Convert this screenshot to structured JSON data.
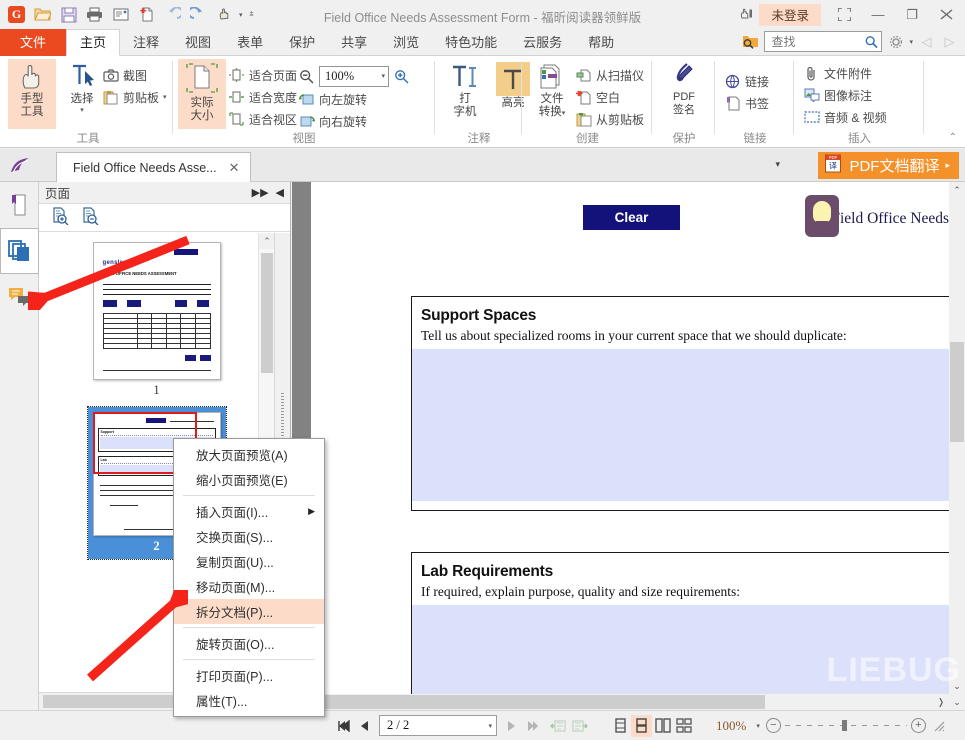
{
  "window": {
    "title": "Field Office Needs Assessment Form - 福昕阅读器领鲜版",
    "login_status": "未登录",
    "minimize": "—",
    "maximize": "❐",
    "close": "✕",
    "restore_icon": "⛶"
  },
  "quick_access": [
    {
      "name": "app-logo",
      "glyph": "G"
    },
    {
      "name": "open-icon",
      "glyph": "📂"
    },
    {
      "name": "save-icon",
      "glyph": "💾"
    },
    {
      "name": "print-icon",
      "glyph": "🖨"
    },
    {
      "name": "email-icon",
      "glyph": "✉"
    },
    {
      "name": "new-from-file-icon",
      "glyph": "❇"
    },
    {
      "name": "undo-icon",
      "glyph": "↶"
    },
    {
      "name": "redo-icon",
      "glyph": "↷"
    },
    {
      "name": "hand-tool-icon",
      "glyph": "☝"
    }
  ],
  "menu_tabs": [
    {
      "label": "文件",
      "active": false,
      "file": true
    },
    {
      "label": "主页",
      "active": true,
      "file": false
    },
    {
      "label": "注释",
      "active": false,
      "file": false
    },
    {
      "label": "视图",
      "active": false,
      "file": false
    },
    {
      "label": "表单",
      "active": false,
      "file": false
    },
    {
      "label": "保护",
      "active": false,
      "file": false
    },
    {
      "label": "共享",
      "active": false,
      "file": false
    },
    {
      "label": "浏览",
      "active": false,
      "file": false
    },
    {
      "label": "特色功能",
      "active": false,
      "file": false
    },
    {
      "label": "云服务",
      "active": false,
      "file": false
    },
    {
      "label": "帮助",
      "active": false,
      "file": false
    }
  ],
  "search": {
    "placeholder": "查找",
    "value": ""
  },
  "ribbon": {
    "groups": [
      {
        "label": "工具",
        "big": [
          {
            "label1": "手型",
            "label2": "工具",
            "highlight": true,
            "icon": "hand-tool"
          },
          {
            "label1": "选择",
            "label2": "",
            "highlight": false,
            "icon": "select-tool",
            "dropdown": true
          }
        ],
        "small": [
          {
            "label": "截图",
            "icon": "camera-icon"
          },
          {
            "label": "剪贴板",
            "icon": "clipboard-icon",
            "dropdown": true
          }
        ]
      },
      {
        "label": "视图",
        "big": [
          {
            "label1": "实际",
            "label2": "大小",
            "highlight": true,
            "icon": "actual-size"
          }
        ],
        "small": [
          {
            "label": "适合页面",
            "icon": "fit-page-icon"
          },
          {
            "label": "适合宽度",
            "icon": "fit-width-icon"
          },
          {
            "label": "适合视区",
            "icon": "fit-visible-icon"
          }
        ],
        "small2": [
          {
            "label": "向左旋转",
            "icon": "rotate-left-icon"
          },
          {
            "label": "向右旋转",
            "icon": "rotate-right-icon"
          }
        ],
        "zoom": {
          "value": "100%",
          "zoom_out": "zoom-out-icon",
          "zoom_in": "zoom-in-icon"
        }
      },
      {
        "label": "注释",
        "big": [
          {
            "label1": "打",
            "label2": "字机",
            "highlight": false,
            "icon": "typewriter"
          },
          {
            "label1": "高亮",
            "label2": "",
            "highlight": true,
            "icon": "highlight"
          }
        ]
      },
      {
        "label": "创建",
        "big": [
          {
            "label1": "文件",
            "label2": "转换",
            "highlight": false,
            "icon": "file-convert",
            "dropdown": true
          }
        ],
        "small": [
          {
            "label": "从扫描仪",
            "icon": "scanner-icon"
          },
          {
            "label": "空白",
            "icon": "blank-page-icon"
          },
          {
            "label": "从剪贴板",
            "icon": "from-clipboard-icon"
          }
        ]
      },
      {
        "label": "保护",
        "big": [
          {
            "label1": "PDF",
            "label2": "签名",
            "highlight": false,
            "icon": "pdf-sign"
          }
        ]
      },
      {
        "label": "链接",
        "small": [
          {
            "label": "链接",
            "icon": "link-icon"
          },
          {
            "label": "书签",
            "icon": "bookmark-icon"
          }
        ]
      },
      {
        "label": "插入",
        "small": [
          {
            "label": "文件附件",
            "icon": "attachment-icon"
          },
          {
            "label": "图像标注",
            "icon": "image-annot-icon"
          },
          {
            "label": "音频 & 视频",
            "icon": "media-icon"
          }
        ]
      }
    ]
  },
  "doc_tab": {
    "label": "Field Office Needs Asse...",
    "close": "✕"
  },
  "translate_button": {
    "label": "PDF文档翻译",
    "arrow": "▸",
    "badge": "译"
  },
  "rail": [
    {
      "name": "bookmark-panel",
      "active": false
    },
    {
      "name": "pages-panel",
      "active": true
    },
    {
      "name": "comments-panel",
      "active": false
    }
  ],
  "pages_panel": {
    "title": "页面",
    "expand_icon": "▶▶",
    "collapse_icon": "◀",
    "toolbar": [
      {
        "name": "enlarge-thumbnail-icon",
        "label": "放大页面预览"
      },
      {
        "name": "reduce-thumbnail-icon",
        "label": "缩小页面预览"
      }
    ],
    "thumbnails": [
      {
        "page": "1",
        "selected": false
      },
      {
        "page": "2",
        "selected": true
      }
    ]
  },
  "context_menu": [
    {
      "label": "放大页面预览(A)",
      "highlight": false,
      "submenu": false,
      "sep_after": false
    },
    {
      "label": "缩小页面预览(E)",
      "highlight": false,
      "submenu": false,
      "sep_after": true
    },
    {
      "label": "插入页面(I)...",
      "highlight": false,
      "submenu": true,
      "sep_after": false
    },
    {
      "label": "交换页面(S)...",
      "highlight": false,
      "submenu": false,
      "sep_after": false
    },
    {
      "label": "复制页面(U)...",
      "highlight": false,
      "submenu": false,
      "sep_after": false
    },
    {
      "label": "移动页面(M)...",
      "highlight": false,
      "submenu": false,
      "sep_after": false
    },
    {
      "label": "拆分文档(P)...",
      "highlight": true,
      "submenu": false,
      "sep_after": true
    },
    {
      "label": "旋转页面(O)...",
      "highlight": false,
      "submenu": false,
      "sep_after": true
    },
    {
      "label": "打印页面(P)...",
      "highlight": false,
      "submenu": false,
      "sep_after": false
    },
    {
      "label": "属性(T)...",
      "highlight": false,
      "submenu": false,
      "sep_after": false
    }
  ],
  "document": {
    "clear_button": "Clear",
    "brand_text": "Field Office Needs",
    "sections": [
      {
        "heading": "Support Spaces",
        "prompt": "Tell us about specialized rooms in your current space that we should duplicate:",
        "answer": ""
      },
      {
        "heading": "Lab Requirements",
        "prompt": "If required, explain purpose, quality and size requirements:",
        "answer": ""
      }
    ]
  },
  "status_bar": {
    "first_page_icon": "⏮",
    "prev_page_icon": "◀",
    "page_value": "2 / 2",
    "next_page_icon": "▶",
    "last_page_icon": "⏭",
    "prev_view_icon": "prev-view-icon",
    "next_view_icon": "next-view-icon",
    "layout_single": "single-page-icon",
    "layout_continuous": "continuous-page-icon",
    "layout_facing": "facing-page-icon",
    "layout_continuous_facing": "continuous-facing-icon",
    "zoom_value": "100%",
    "zoom_out": "−",
    "zoom_in": "+",
    "resize_grip": "resize-grip-icon"
  },
  "watermark": "LIEBUG"
}
